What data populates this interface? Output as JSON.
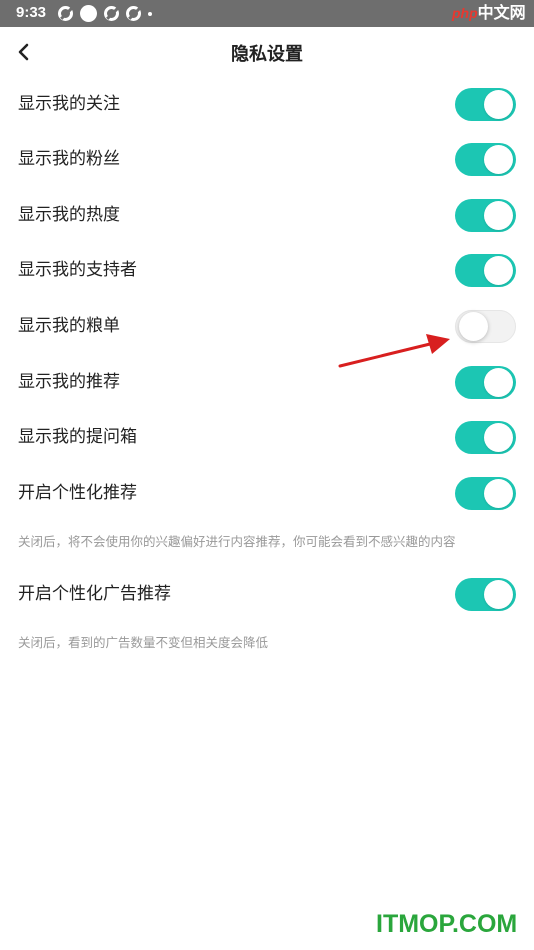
{
  "status_bar": {
    "time": "9:33",
    "watermark_php": "php",
    "watermark_cn": "中文网"
  },
  "header": {
    "title": "隐私设置"
  },
  "settings": [
    {
      "label": "显示我的关注",
      "enabled": true
    },
    {
      "label": "显示我的粉丝",
      "enabled": true
    },
    {
      "label": "显示我的热度",
      "enabled": true
    },
    {
      "label": "显示我的支持者",
      "enabled": true
    },
    {
      "label": "显示我的粮单",
      "enabled": false
    },
    {
      "label": "显示我的推荐",
      "enabled": true
    },
    {
      "label": "显示我的提问箱",
      "enabled": true
    },
    {
      "label": "开启个性化推荐",
      "enabled": true,
      "note": "关闭后，将不会使用你的兴趣偏好进行内容推荐，你可能会看到不感兴趣的内容"
    },
    {
      "label": "开启个性化广告推荐",
      "enabled": true,
      "note": "关闭后，看到的广告数量不变但相关度会降低"
    }
  ],
  "footer_watermark": "ITMOP.COM",
  "colors": {
    "accent": "#1cc6b3",
    "status_bar": "#6e6e6e",
    "annotation_arrow": "#d81f1f"
  }
}
